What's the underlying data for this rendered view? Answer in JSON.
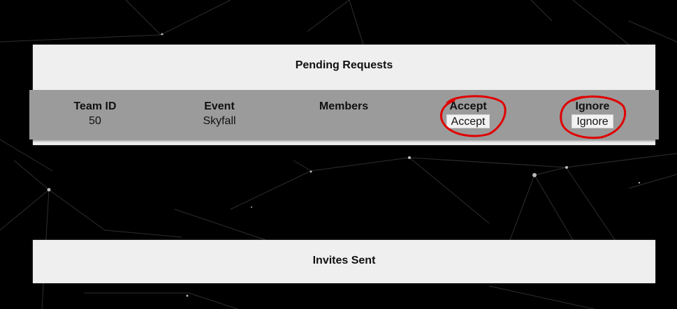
{
  "pending": {
    "title": "Pending Requests",
    "columns": [
      "Team ID",
      "Event",
      "Members",
      "Accept",
      "Ignore"
    ],
    "rows": [
      {
        "team_id": "50",
        "event": "Skyfall",
        "members": "",
        "accept_label": "Accept",
        "ignore_label": "Ignore"
      }
    ]
  },
  "invites": {
    "title": "Invites Sent"
  },
  "colors": {
    "background": "#000000",
    "panel": "#efefef",
    "table_band": "#9b9b9b",
    "annotation": "#e00000"
  }
}
